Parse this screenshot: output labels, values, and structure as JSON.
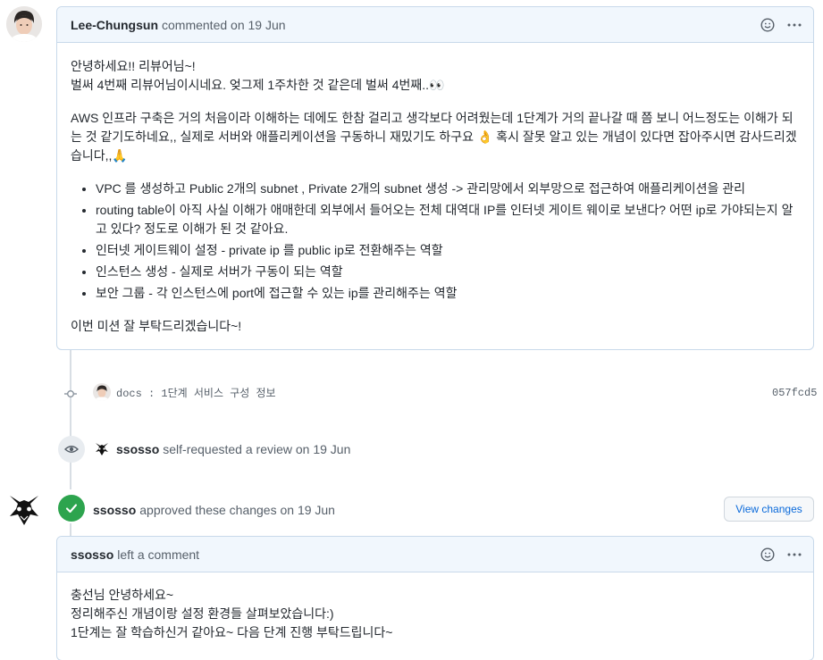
{
  "comment1": {
    "author": "Lee-Chungsun",
    "meta": "commented on 19 Jun",
    "greeting1": "안녕하세요!! 리뷰어님~!",
    "greeting2": "벌써 4번째 리뷰어님이시네요. 엊그제 1주차한 것 같은데 벌써 4번째..",
    "greeting2_emoji": "👀",
    "para1": "AWS 인프라 구축은 거의 처음이라 이해하는 데에도 한참 걸리고 생각보다 어려웠는데 1단계가 거의 끝나갈 때 쯤 보니 어느정도는 이해가 되는 것 같기도하네요,, 실제로 서버와 애플리케이션을 구동하니 재밌기도 하구요 ",
    "para1_emoji1": "👌",
    "para1_cont": " 혹시 잘못 알고 있는 개념이 있다면 잡아주시면 감사드리겠습니다,,",
    "para1_emoji2": "🙏",
    "bullets": [
      "VPC 를 생성하고 Public 2개의 subnet , Private 2개의 subnet 생성 -> 관리망에서 외부망으로 접근하여 애플리케이션을 관리",
      "routing table이 아직 사실 이해가 애매한데 외부에서 들어오는 전체 대역대 IP를 인터넷 게이트 웨이로 보낸다? 어떤 ip로 가야되는지 알고 있다? 정도로 이해가 된 것 같아요.",
      "인터넷 게이트웨이 설정 - private ip 를 public ip로 전환해주는 역할",
      "인스턴스 생성 - 실제로 서버가 구동이 되는 역할",
      "보안 그룹 - 각 인스턴스에 port에 접근할 수 있는 ip를 관리해주는 역할"
    ],
    "closing": "이번 미션 잘 부탁드리겠습니다~!"
  },
  "commit": {
    "message": "docs : 1단계 서비스 구성 정보",
    "sha": "057fcd5"
  },
  "review_request": {
    "actor": "ssosso",
    "text": "self-requested a review on 19 Jun"
  },
  "approval": {
    "actor": "ssosso",
    "text": "approved these changes on 19 Jun",
    "button": "View changes"
  },
  "comment2": {
    "author": "ssosso",
    "meta": "left a comment",
    "line1": "충선님 안녕하세요~",
    "line2": "정리해주신 개념이랑 설정 환경들 살펴보았습니다:)",
    "line3": "1단계는 잘 학습하신거 같아요~ 다음 단계 진행 부탁드립니다~"
  },
  "icons": {
    "smiley": "smiley-icon",
    "kebab": "kebab-icon",
    "eye": "eye-icon",
    "check": "check-icon",
    "commit": "git-commit-icon"
  },
  "colors": {
    "header_bg": "#f1f7fd",
    "border": "#c8d9ea",
    "approve_green": "#2da44e",
    "link_blue": "#0969da"
  }
}
